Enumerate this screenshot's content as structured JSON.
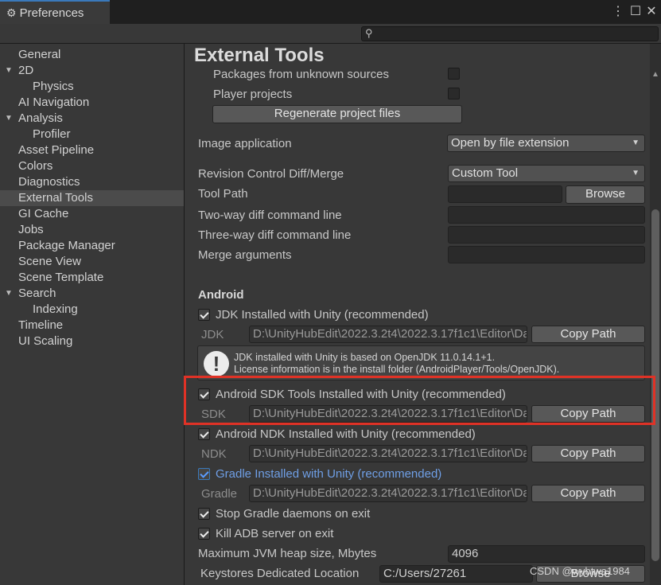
{
  "window": {
    "tab_title": "Preferences",
    "search_placeholder": ""
  },
  "sidebar": {
    "items": [
      {
        "label": "General"
      },
      {
        "label": "2D"
      },
      {
        "label": "Physics"
      },
      {
        "label": "AI Navigation"
      },
      {
        "label": "Analysis"
      },
      {
        "label": "Profiler"
      },
      {
        "label": "Asset Pipeline"
      },
      {
        "label": "Colors"
      },
      {
        "label": "Diagnostics"
      },
      {
        "label": "External Tools",
        "selected": true
      },
      {
        "label": "GI Cache"
      },
      {
        "label": "Jobs"
      },
      {
        "label": "Package Manager"
      },
      {
        "label": "Scene View"
      },
      {
        "label": "Scene Template"
      },
      {
        "label": "Search"
      },
      {
        "label": "Indexing"
      },
      {
        "label": "Timeline"
      },
      {
        "label": "UI Scaling"
      }
    ]
  },
  "main": {
    "title": "External Tools",
    "packages_unknown_label": "Packages from unknown sources",
    "player_projects_label": "Player projects",
    "regenerate_label": "Regenerate project files",
    "image_app_label": "Image application",
    "image_app_value": "Open by file extension",
    "revision_label": "Revision Control Diff/Merge",
    "revision_value": "Custom Tool",
    "tool_path_label": "Tool Path",
    "browse_label": "Browse",
    "two_way_label": "Two-way diff command line",
    "three_way_label": "Three-way diff command line",
    "merge_args_label": "Merge arguments",
    "android_heading": "Android",
    "jdk_check_label": "JDK Installed with Unity (recommended)",
    "jdk_label": "JDK",
    "jdk_path": "D:\\UnityHubEdit\\2022.3.2t4\\2022.3.17f1c1\\Editor\\Data\\PlaybackEngines\\AndroidPlayer\\OpenJDK",
    "copy_path_label": "Copy Path",
    "help_line1": "JDK installed with Unity is based on OpenJDK 11.0.14.1+1.",
    "help_line2": "License information is in the install folder (AndroidPlayer/Tools/OpenJDK).",
    "sdk_check_label": "Android SDK Tools Installed with Unity (recommended)",
    "sdk_label": "SDK",
    "sdk_path": "D:\\UnityHubEdit\\2022.3.2t4\\2022.3.17f1c1\\Editor\\Data\\PlaybackEngines\\AndroidPlayer\\SDK",
    "ndk_check_label": "Android NDK Installed with Unity (recommended)",
    "ndk_label": "NDK",
    "ndk_path": "D:\\UnityHubEdit\\2022.3.2t4\\2022.3.17f1c1\\Editor\\Data\\PlaybackEngines\\AndroidPlayer\\NDK",
    "gradle_check_label": "Gradle Installed with Unity (recommended)",
    "gradle_label": "Gradle",
    "gradle_path": "D:\\UnityHubEdit\\2022.3.2t4\\2022.3.17f1c1\\Editor\\Data\\PlaybackEngines\\AndroidPlayer\\Tools\\gradle",
    "stop_gradle_label": "Stop Gradle daemons on exit",
    "kill_adb_label": "Kill ADB server on exit",
    "jvm_heap_label": "Maximum JVM heap size, Mbytes",
    "jvm_heap_value": "4096",
    "keystores_label": "Keystores Dedicated Location",
    "keystores_value": "C:/Users/27261",
    "keystores_browse": "Browse"
  },
  "watermark": "CSDN @wybtwa1984",
  "colors": {
    "accent": "#3a79bb",
    "highlight_box": "#e03226",
    "gradle_label_color": "#6f9fe6"
  }
}
